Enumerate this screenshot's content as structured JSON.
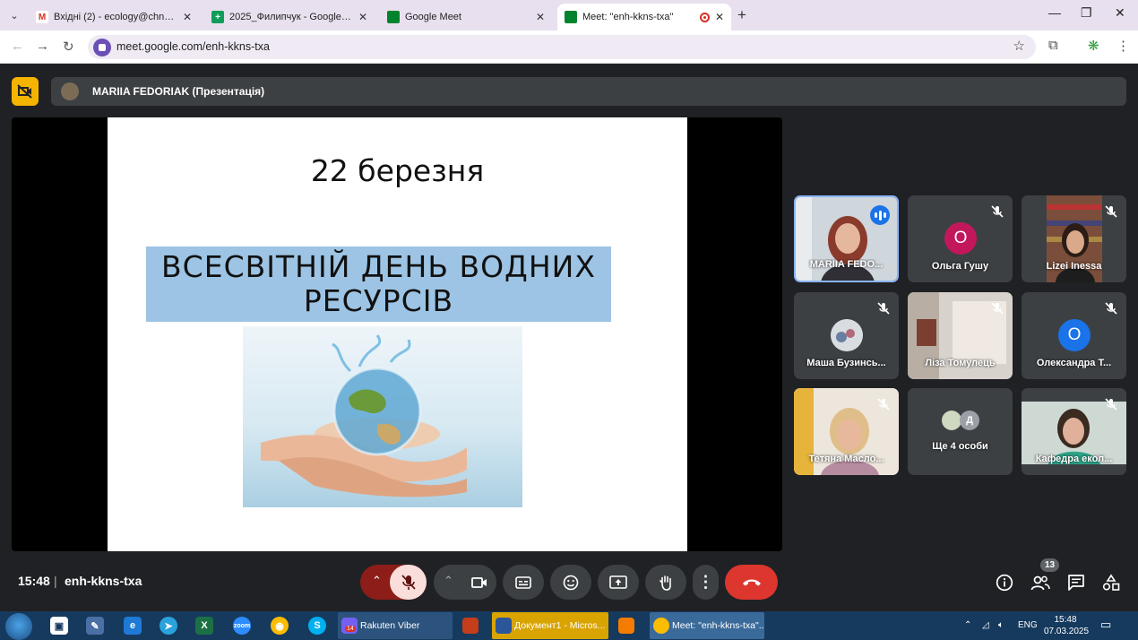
{
  "browser": {
    "tabs": [
      {
        "label": "Вхідні (2) - ecology@chnu.edu.",
        "icon": "gmail-icon"
      },
      {
        "label": "2025_Филипчук - Google Табл",
        "icon": "sheets-icon"
      },
      {
        "label": "Google Meet",
        "icon": "meet-icon"
      },
      {
        "label": "Meet: \"enh-kkns-txa\"",
        "icon": "meet-icon",
        "active": true
      }
    ],
    "url": "meet.google.com/enh-kkns-txa"
  },
  "meet": {
    "presenter_label": "MARIIA FEDORIAK (Презентація)",
    "slide": {
      "date": "22 березня",
      "title_line1": "ВСЕСВІТНІЙ ДЕНЬ ВОДНИХ",
      "title_line2": "РЕСУРСІВ"
    },
    "participants": [
      {
        "name": "MARIIA FEDO...",
        "type": "video",
        "speaking": true
      },
      {
        "name": "Ольга Гушу",
        "type": "letter",
        "letter": "О",
        "color": "#c2185b",
        "muted": true
      },
      {
        "name": "Lizei Inessa",
        "type": "video",
        "muted": true
      },
      {
        "name": "Маша Бузинсь...",
        "type": "avatar",
        "muted": true
      },
      {
        "name": "Ліза Томулець",
        "type": "video",
        "muted": true
      },
      {
        "name": "Олександра Т...",
        "type": "letter",
        "letter": "О",
        "color": "#1a73e8",
        "muted": true
      },
      {
        "name": "Тетяна Масло...",
        "type": "video",
        "muted": true
      },
      {
        "name": "Ще 4 особи",
        "type": "more",
        "letter": "Д"
      },
      {
        "name": "Кафедра екол...",
        "type": "video",
        "muted": true
      }
    ],
    "time": "15:48",
    "separator": "|",
    "meeting_code": "enh-kkns-txa",
    "people_count": "13"
  },
  "taskbar": {
    "apps": [
      {
        "label": "Rakuten Viber",
        "badge": "14"
      },
      {
        "label": ""
      },
      {
        "label": "Документ1 - Micros..."
      },
      {
        "label": ""
      },
      {
        "label": "Meet: \"enh-kkns-txa\"..."
      }
    ],
    "language": "ENG",
    "clock_time": "15:48",
    "clock_date": "07.03.2025"
  }
}
